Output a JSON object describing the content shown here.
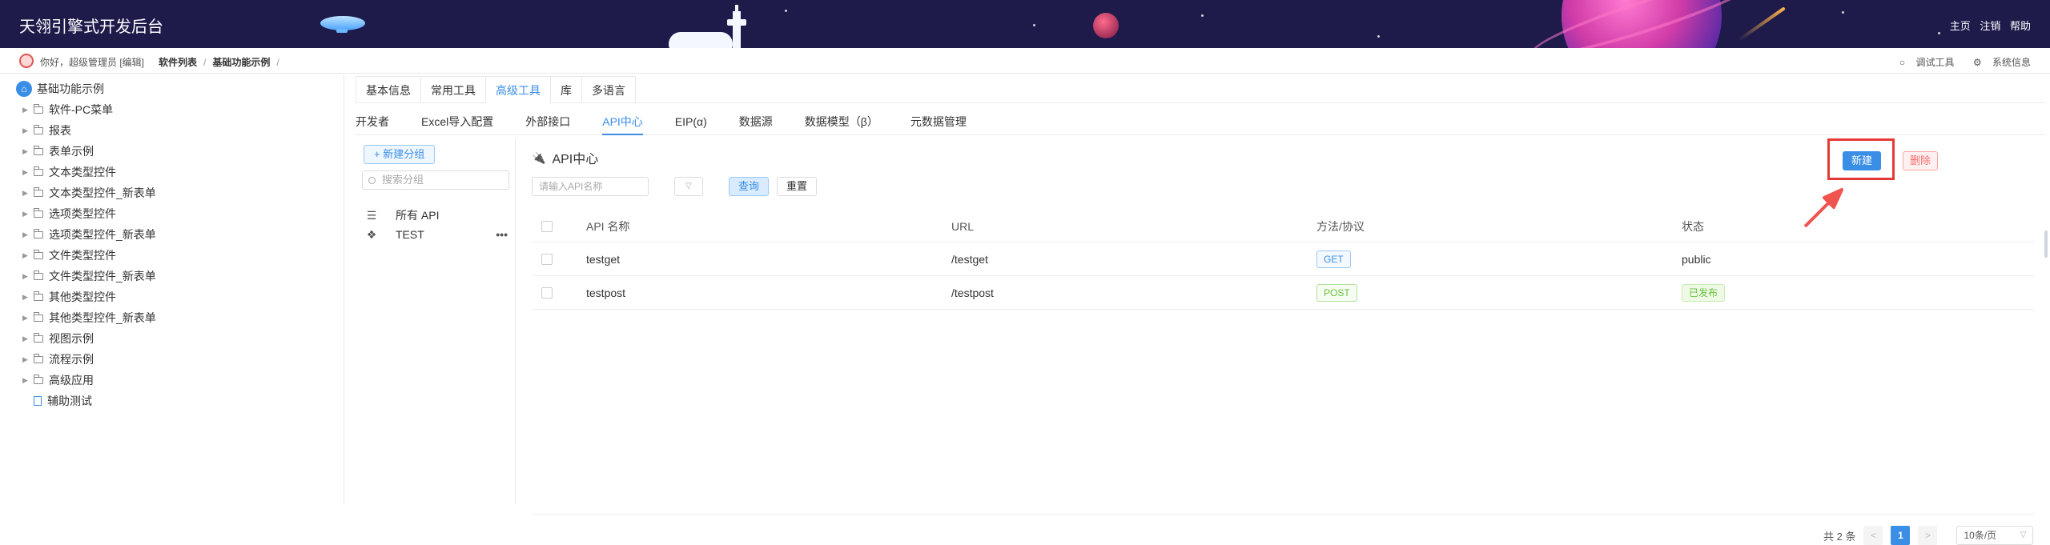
{
  "header": {
    "title": "天翎引擎式开发后台",
    "links": [
      "主页",
      "注销",
      "帮助"
    ]
  },
  "subbar": {
    "greeting": "你好，超级管理员 [编辑]",
    "breadcrumb": [
      "软件列表",
      "基础功能示例"
    ],
    "breadcrumb_trailing": "/",
    "tools": [
      "调试工具",
      "系统信息"
    ]
  },
  "tree": {
    "root": "基础功能示例",
    "items": [
      "软件-PC菜单",
      "报表",
      "表单示例",
      "文本类型控件",
      "文本类型控件_新表单",
      "选项类型控件",
      "选项类型控件_新表单",
      "文件类型控件",
      "文件类型控件_新表单",
      "其他类型控件",
      "其他类型控件_新表单",
      "视图示例",
      "流程示例",
      "高级应用"
    ],
    "leaf": "辅助测试"
  },
  "tabs1": [
    "基本信息",
    "常用工具",
    "高级工具",
    "库",
    "多语言"
  ],
  "tabs1_active": "高级工具",
  "tabs2": [
    "开发者",
    "Excel导入配置",
    "外部接口",
    "API中心",
    "EIP(α)",
    "数据源",
    "数据模型（β）",
    "元数据管理"
  ],
  "groups": {
    "new_button": "+ 新建分组",
    "search_placeholder": "搜索分组",
    "items": [
      {
        "label": "所有 API",
        "icon": "list-icon"
      },
      {
        "label": "TEST",
        "icon": "group-icon",
        "menu": "•••"
      }
    ]
  },
  "api": {
    "title": "API中心",
    "new_button": "新建",
    "delete_button": "删除",
    "search_placeholder": "请输入API名称",
    "select_arrow": "▽",
    "query_button": "查询",
    "reset_button": "重置",
    "columns": [
      "API 名称",
      "URL",
      "方法/协议",
      "状态"
    ],
    "rows": [
      {
        "name": "testget",
        "url": "/testget",
        "method": "GET",
        "status": "public"
      },
      {
        "name": "testpost",
        "url": "/testpost",
        "method": "POST",
        "status": "已发布"
      }
    ]
  },
  "pager": {
    "total": "共 2 条",
    "prev": "<",
    "current": "1",
    "next": ">",
    "page_size": "10条/页"
  },
  "colors": {
    "header_bg": "#1e1b4b",
    "accent": "#3a8ee6",
    "highlight_frame": "#e53935",
    "success": "#67c23a",
    "danger": "#f56c6c"
  }
}
